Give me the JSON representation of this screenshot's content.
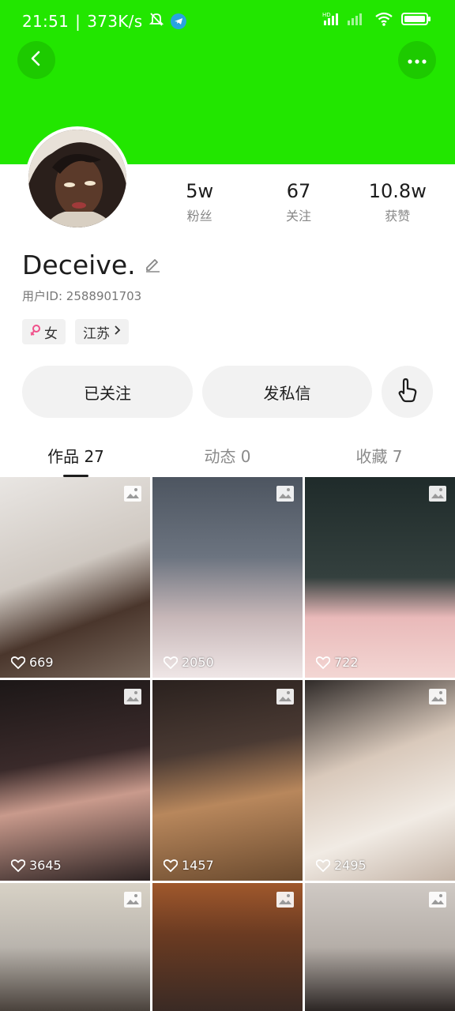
{
  "status_bar": {
    "time": "21:51",
    "speed": "373K/s",
    "indicators": [
      "mute-icon",
      "telegram-icon",
      "signal-icon",
      "wifi-icon",
      "battery-icon"
    ]
  },
  "colors": {
    "header_bg": "#22e600",
    "gender_accent": "#f0508a"
  },
  "header": {
    "back_icon": "chevron-left-icon",
    "more_icon": "more-dots-icon"
  },
  "profile": {
    "name": "Deceive.",
    "user_id": "用户ID: 2588901703",
    "gender": "女",
    "location": "江苏",
    "stats": [
      {
        "value": "5w",
        "label": "粉丝"
      },
      {
        "value": "67",
        "label": "关注"
      },
      {
        "value": "10.8w",
        "label": "获赞"
      }
    ]
  },
  "actions": {
    "follow_label": "已关注",
    "message_label": "发私信",
    "share_icon": "tap-hand-icon"
  },
  "tabs": [
    {
      "label": "作品 27",
      "active": true
    },
    {
      "label": "动态 0",
      "active": false
    },
    {
      "label": "收藏 7",
      "active": false
    }
  ],
  "posts": [
    {
      "likes": "669"
    },
    {
      "likes": "2050"
    },
    {
      "likes": "722"
    },
    {
      "likes": "3645"
    },
    {
      "likes": "1457"
    },
    {
      "likes": "2495"
    },
    {
      "likes": ""
    },
    {
      "likes": ""
    },
    {
      "likes": ""
    }
  ]
}
